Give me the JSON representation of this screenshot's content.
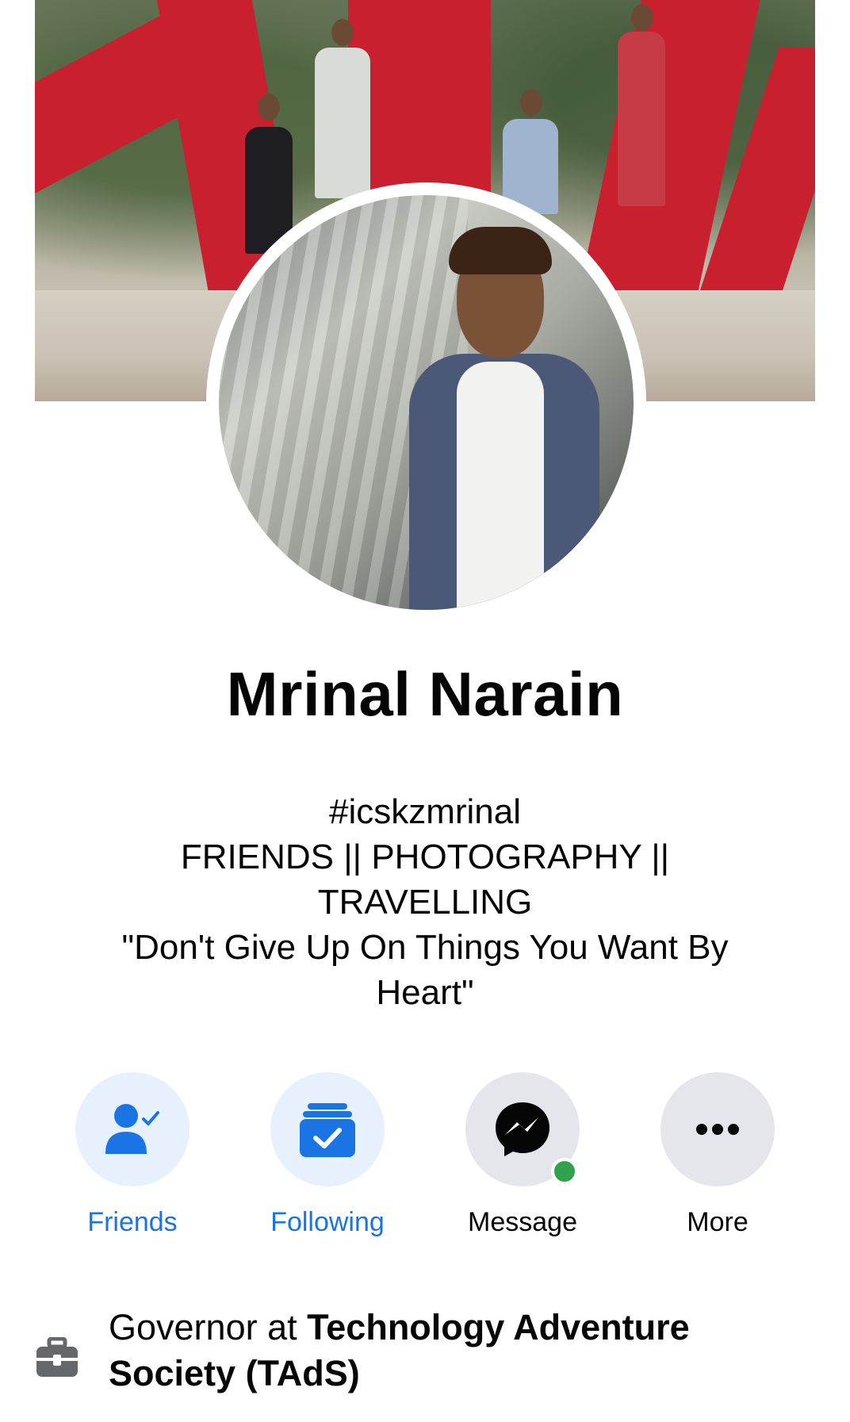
{
  "profile": {
    "name": "Mrinal Narain",
    "bio": [
      "#icskzmrinal",
      "FRIENDS || PHOTOGRAPHY ||",
      "TRAVELLING",
      "\"Don't Give Up On Things You Want By",
      "Heart\""
    ]
  },
  "actions": {
    "friends": {
      "label": "Friends",
      "icon": "friend-check-icon"
    },
    "following": {
      "label": "Following",
      "icon": "following-check-icon"
    },
    "message": {
      "label": "Message",
      "icon": "messenger-icon",
      "online": true
    },
    "more": {
      "label": "More",
      "icon": "more-dots-icon"
    }
  },
  "work": {
    "prefix": "Governor at ",
    "org": "Technology Adventure Society (TAdS)",
    "icon": "briefcase-icon"
  },
  "colors": {
    "accent": "#1b74e4",
    "accent_bg": "#e7f0fd",
    "neutral_bg": "#e4e6eb",
    "online": "#31a24c"
  }
}
